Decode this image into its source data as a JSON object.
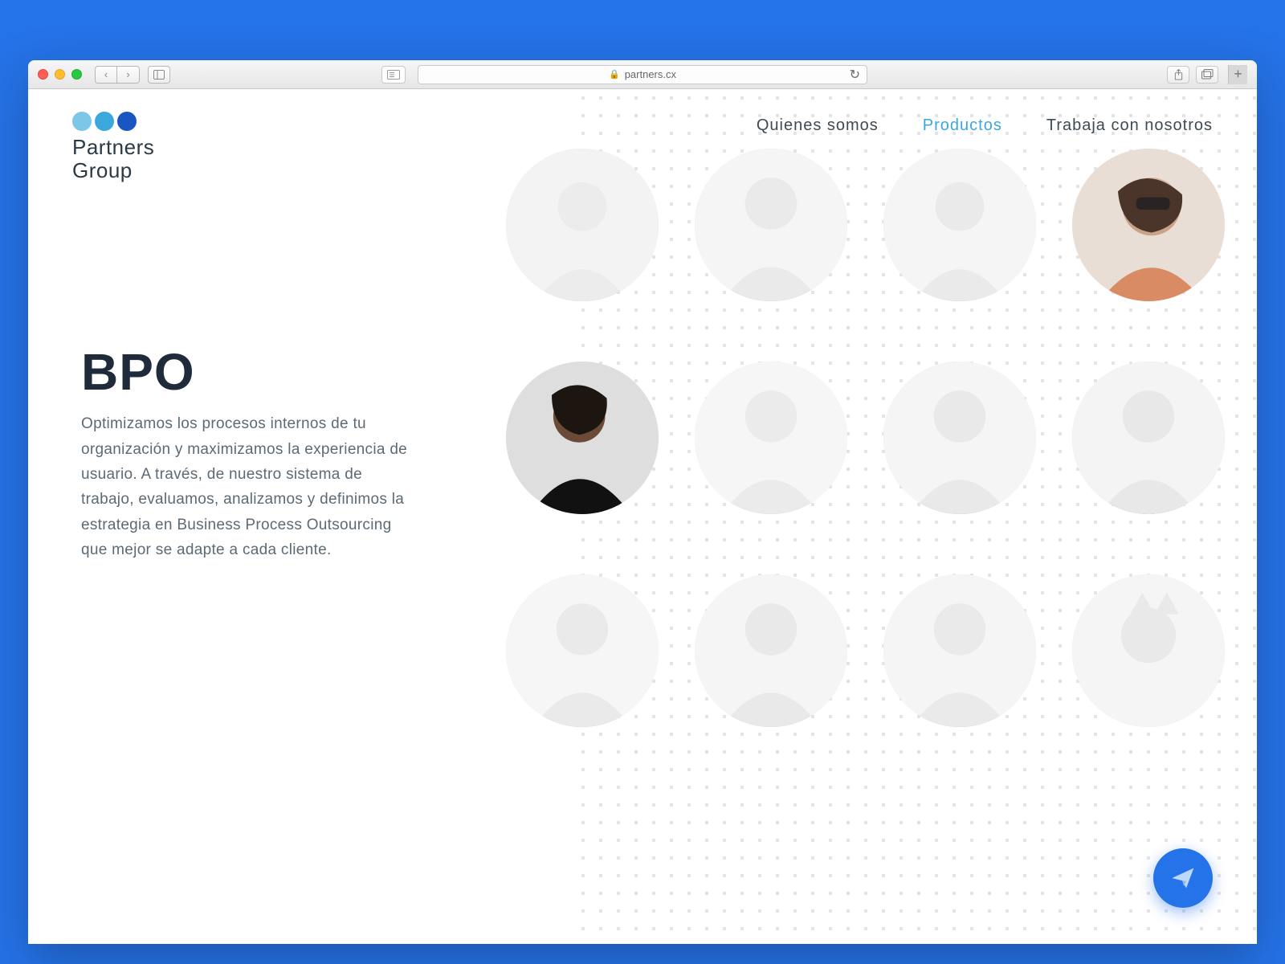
{
  "browser": {
    "url_host": "partners.cx",
    "secure": true
  },
  "brand": {
    "name_line1": "Partners",
    "name_line2": "Group",
    "dot_colors": [
      "#7cc6e8",
      "#3aa8dd",
      "#1a56c2"
    ]
  },
  "nav": {
    "items": [
      {
        "label": "Quienes somos",
        "active": false
      },
      {
        "label": "Productos",
        "active": true
      },
      {
        "label": "Trabaja con nosotros",
        "active": false
      }
    ]
  },
  "hero": {
    "title": "BPO",
    "body": "Optimizamos los procesos internos de tu organización y maximizamos la experiencia de usuario. A través, de nuestro sistema de trabajo, evaluamos, analizamos y definimos la estrategia en Business Process Outsourcing que mejor se adapte a cada cliente."
  },
  "grid": {
    "rows": 3,
    "cols": 4,
    "highlighted_indices": [
      3,
      4
    ]
  },
  "fab": {
    "icon": "paper-plane-icon"
  },
  "colors": {
    "page_bg": "#2573e8",
    "accent": "#3aa8dd",
    "text_heading": "#1f2b3a",
    "text_body": "#5b6a74"
  }
}
